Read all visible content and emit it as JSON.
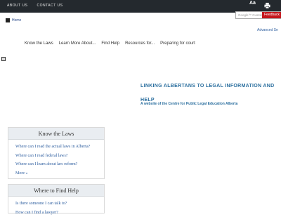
{
  "topbar": {
    "links": [
      "ABOUT US",
      "CONTACT US"
    ],
    "font_size_label": "Aa",
    "print_icon": "printer-icon"
  },
  "breadcrumb": {
    "home_label": "Home",
    "home_icon": "home-icon"
  },
  "search": {
    "placeholder": "Google™ Custom Search",
    "feedback_label": "Feedback",
    "advanced_label": "Advanced Se"
  },
  "main_nav": [
    "Know the Laws",
    "Learn More About...",
    "Find Help",
    "Resources for...",
    "Preparing for court"
  ],
  "hero": {
    "headline": "LINKING ALBERTANS TO LEGAL INFORMATION AND HELP",
    "subhead": "A website of the Centre for Public Legal Education Alberta"
  },
  "panels": {
    "know_the_laws": {
      "title": "Know the Laws",
      "links": [
        "Where can I read the actual laws in Alberta?",
        "Where can I read federal laws?",
        "Where can I learn about law reform?",
        "More »"
      ]
    },
    "where_to_find_help": {
      "title": "Where to Find Help",
      "links": [
        "Is there someone I can talk to?",
        "How can I find a lawyer?"
      ]
    }
  },
  "colors": {
    "topbar_bg": "#24292e",
    "accent_blue": "#2a6e9e",
    "link_blue": "#2b5c9e",
    "feedback_red": "#c4161c"
  }
}
